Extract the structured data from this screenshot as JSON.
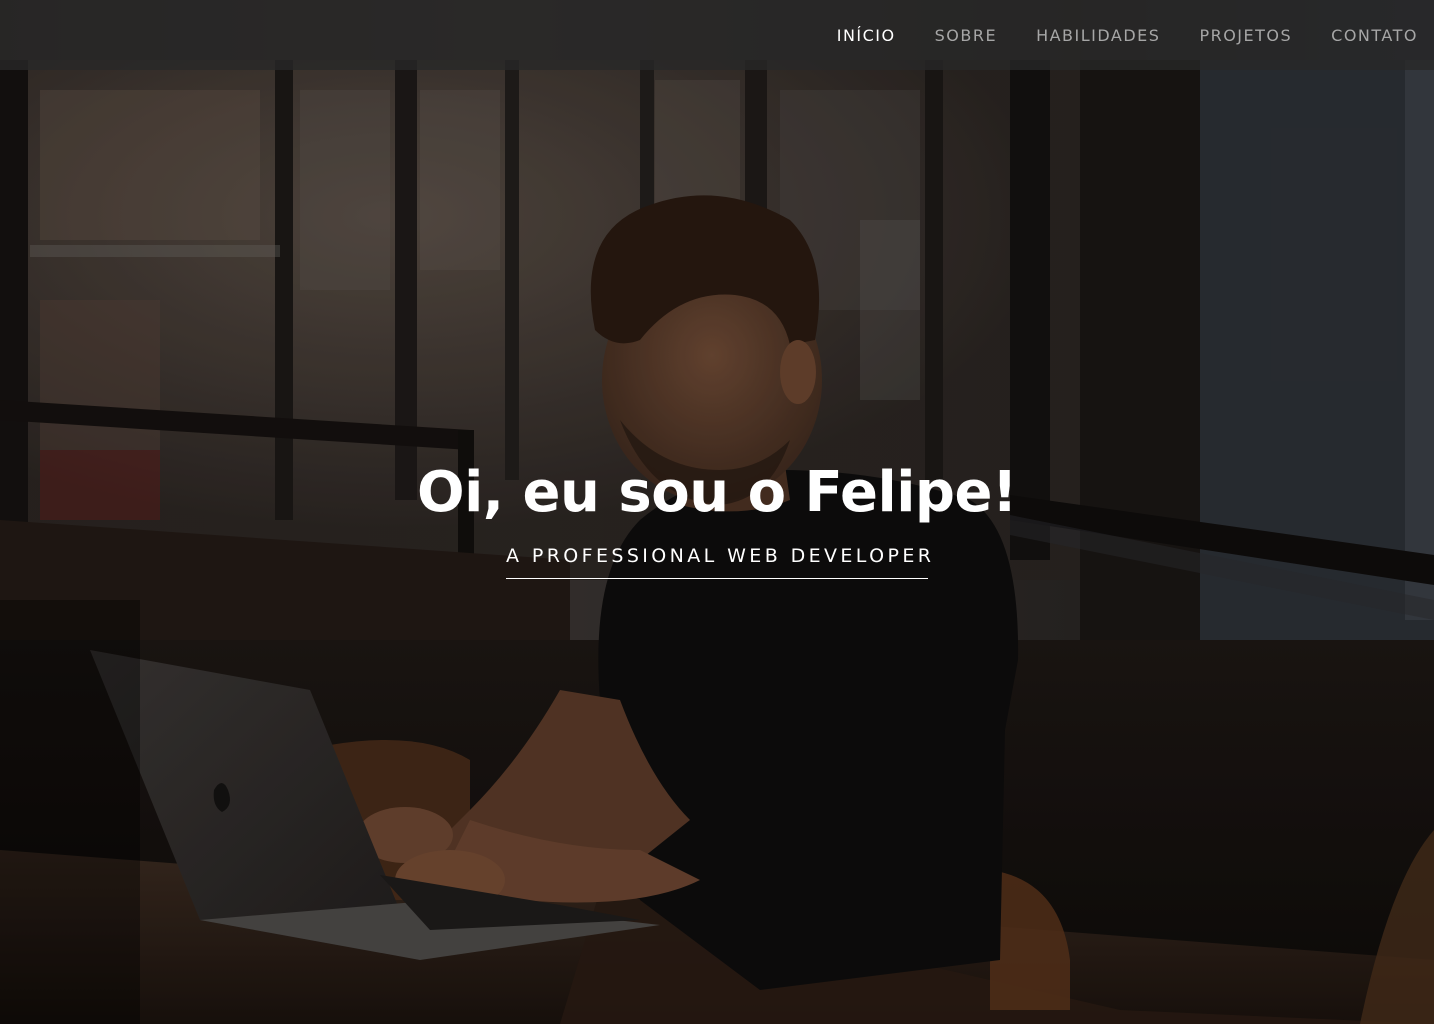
{
  "nav": {
    "items": [
      {
        "label": "INÍCIO",
        "active": true
      },
      {
        "label": "SOBRE",
        "active": false
      },
      {
        "label": "HABILIDADES",
        "active": false
      },
      {
        "label": "PROJETOS",
        "active": false
      },
      {
        "label": "CONTATO",
        "active": false
      }
    ]
  },
  "hero": {
    "title": "Oi, eu sou o Felipe!",
    "subtitle": "A PROFESSIONAL WEB DEVELOPER"
  },
  "colors": {
    "nav_background": "#282828",
    "nav_text": "#a6a6a6",
    "nav_active_text": "#ffffff",
    "hero_text": "#ffffff"
  }
}
